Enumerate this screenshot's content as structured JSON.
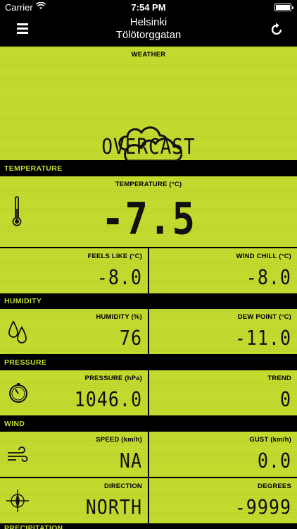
{
  "status_bar": {
    "carrier": "Carrier",
    "time": "7:54 PM"
  },
  "nav": {
    "city": "Helsinki",
    "station": "Tölötorggatan"
  },
  "weather": {
    "label": "WEATHER",
    "condition": "OVERCAST",
    "icon": "cloud-icon"
  },
  "temperature_section": {
    "header": "TEMPERATURE",
    "main": {
      "label": "TEMPERATURE (°C)",
      "value": "-7.5",
      "icon": "thermometer-icon"
    },
    "feels_like": {
      "label": "FEELS LIKE (°C)",
      "value": "-8.0"
    },
    "wind_chill": {
      "label": "WIND CHILL (°C)",
      "value": "-8.0"
    }
  },
  "humidity_section": {
    "header": "HUMIDITY",
    "humidity": {
      "label": "HUMIDITY (%)",
      "value": "76",
      "icon": "droplets-icon"
    },
    "dew_point": {
      "label": "DEW POINT (°C)",
      "value": "-11.0"
    }
  },
  "pressure_section": {
    "header": "PRESSURE",
    "pressure": {
      "label": "PRESSURE (hPa)",
      "value": "1046.0",
      "icon": "gauge-icon"
    },
    "trend": {
      "label": "TREND",
      "value": "0"
    }
  },
  "wind_section": {
    "header": "WIND",
    "speed": {
      "label": "SPEED (km/h)",
      "value": "NA",
      "icon": "wind-icon"
    },
    "gust": {
      "label": "GUST (km/h)",
      "value": "0.0"
    },
    "direction": {
      "label": "DIRECTION",
      "value": "NORTH",
      "icon": "compass-icon"
    },
    "degrees": {
      "label": "DEGREES",
      "value": "-9999"
    }
  },
  "next_section": {
    "header": "PRECIPITATION"
  },
  "colors": {
    "lcd": "#c5dc2f",
    "background": "#000000",
    "header_text": "#c5dc2f"
  }
}
